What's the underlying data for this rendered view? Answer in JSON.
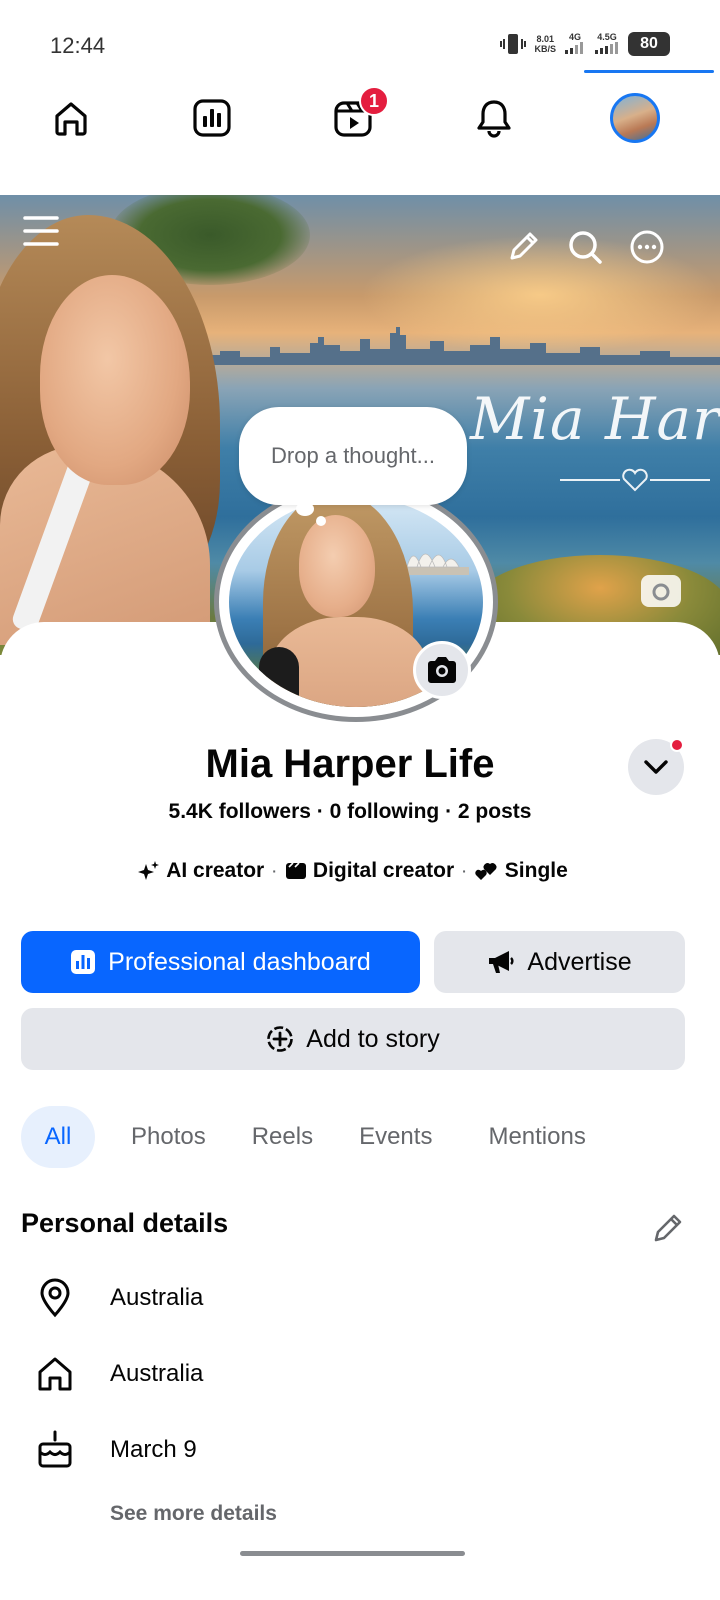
{
  "status_bar": {
    "time": "12:44",
    "net_speed": "8.01",
    "net_unit": "KB/S",
    "signal1_label": "4G",
    "signal2_label": "4.5G",
    "battery": "80"
  },
  "top_nav": {
    "items": [
      {
        "icon": "home-icon"
      },
      {
        "icon": "dashboard-icon"
      },
      {
        "icon": "reels-icon",
        "badge": "1"
      },
      {
        "icon": "bell-icon"
      },
      {
        "icon": "profile-avatar"
      }
    ]
  },
  "cover": {
    "signature": "Mia Harper"
  },
  "thought_bubble": {
    "placeholder": "Drop a thought..."
  },
  "profile": {
    "name": "Mia Harper Life",
    "stats": "5.4K followers · 0 following · 2 posts",
    "tags": [
      {
        "icon": "sparkle-icon",
        "label": "AI creator"
      },
      {
        "icon": "creator-icon",
        "label": "Digital creator"
      },
      {
        "icon": "hearts-icon",
        "label": "Single"
      }
    ]
  },
  "actions": {
    "dashboard_label": "Professional dashboard",
    "advertise_label": "Advertise",
    "story_label": "Add to story"
  },
  "tabs": [
    {
      "label": "All",
      "active": true
    },
    {
      "label": "Photos"
    },
    {
      "label": "Reels"
    },
    {
      "label": "Events"
    },
    {
      "label": "Mentions"
    }
  ],
  "personal_details": {
    "title": "Personal details",
    "rows": [
      {
        "icon": "location-pin-icon",
        "text": "Australia"
      },
      {
        "icon": "home-icon",
        "text": "Australia"
      },
      {
        "icon": "birthday-cake-icon",
        "text": "March 9"
      }
    ],
    "see_more": "See more details"
  },
  "colors": {
    "accent": "#0866ff",
    "badge": "#e41e3f",
    "secondary_button": "#e4e6eb",
    "muted_text": "#65676b"
  }
}
